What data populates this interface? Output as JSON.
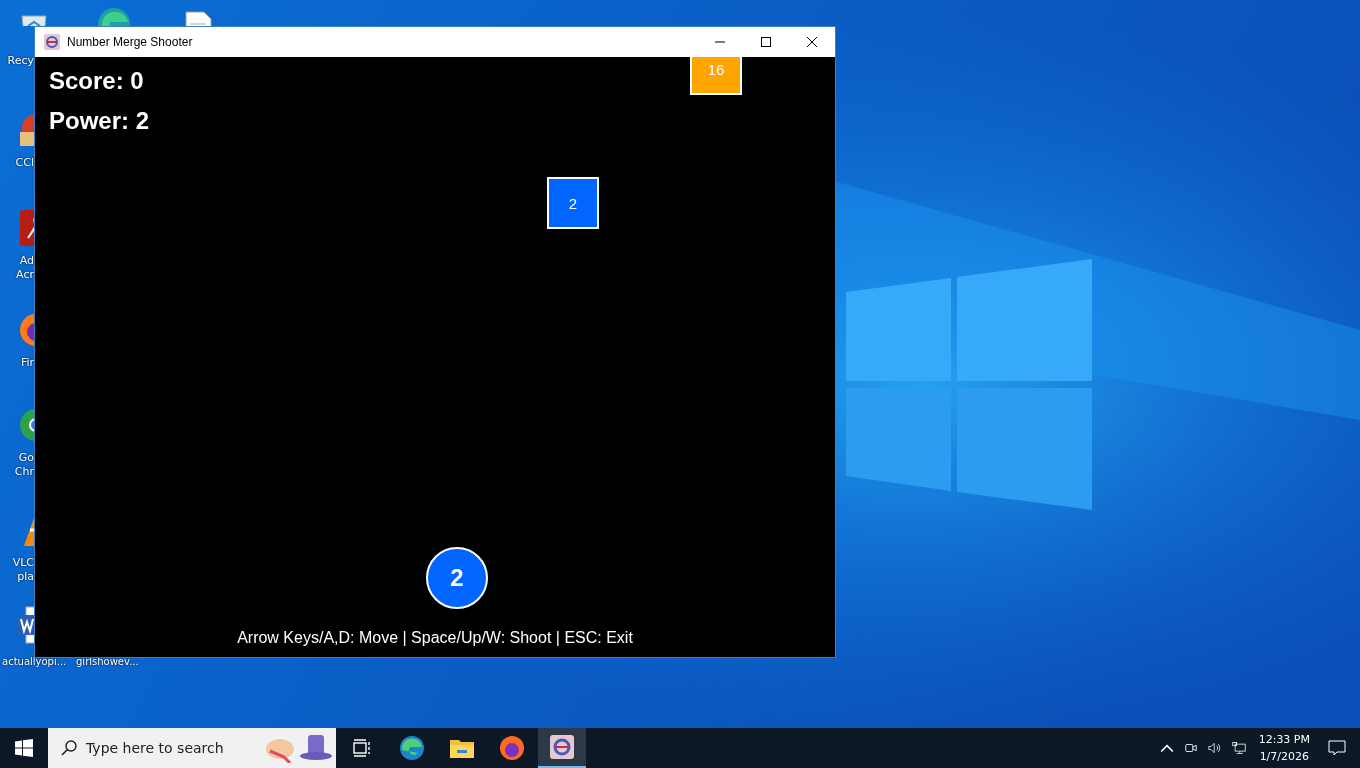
{
  "window": {
    "title": "Number Merge Shooter"
  },
  "game": {
    "score": "Score: 0",
    "power": "Power: 2",
    "blocks": [
      {
        "value": "2",
        "color": "#0066ff"
      },
      {
        "value": "16",
        "color": "#ffa500"
      }
    ],
    "shooter": "2",
    "hint": "Arrow Keys/A,D: Move | Space/Up/W: Shoot | ESC: Exit"
  },
  "desktop_icons": [
    {
      "kind": "recycle",
      "lines": [
        "Recy"
      ]
    },
    {
      "kind": "edge"
    },
    {
      "kind": "file"
    },
    {
      "kind": "ccleaner",
      "lines": [
        "CCl"
      ]
    },
    {
      "kind": "acrobat",
      "lines": [
        "Ad",
        "Acr"
      ]
    },
    {
      "kind": "firefox",
      "lines": [
        "Fir"
      ]
    },
    {
      "kind": "chrome",
      "lines": [
        "Go",
        "Chr"
      ]
    },
    {
      "kind": "vlc",
      "lines": [
        "VLC",
        "pla"
      ]
    },
    {
      "kind": "word",
      "lines": [
        "actuallyopi..."
      ]
    },
    {
      "kind": "hidden",
      "lines": [
        "girlshowev..."
      ]
    }
  ],
  "taskbar": {
    "search": {
      "placeholder": "Type here to search"
    },
    "apps": [
      {
        "kind": "taskview",
        "selected": false
      },
      {
        "kind": "edge",
        "selected": false
      },
      {
        "kind": "explorer",
        "selected": false
      },
      {
        "kind": "firefox",
        "selected": false
      },
      {
        "kind": "game",
        "selected": true
      }
    ],
    "clock": {
      "time": "12:33 PM",
      "date": "1/7/2026"
    }
  }
}
